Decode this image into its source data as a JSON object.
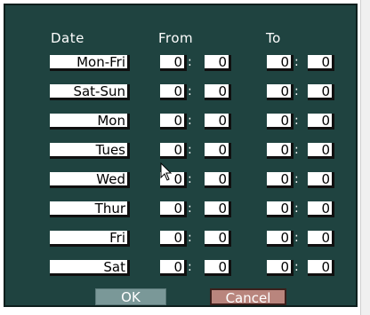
{
  "headers": {
    "date": "Date",
    "from": "From",
    "to": "To"
  },
  "rows": [
    {
      "day": "Mon-Fri",
      "from_h": "0",
      "from_m": "0",
      "to_h": "0",
      "to_m": "0"
    },
    {
      "day": "Sat-Sun",
      "from_h": "0",
      "from_m": "0",
      "to_h": "0",
      "to_m": "0"
    },
    {
      "day": "Mon",
      "from_h": "0",
      "from_m": "0",
      "to_h": "0",
      "to_m": "0"
    },
    {
      "day": "Tues",
      "from_h": "0",
      "from_m": "0",
      "to_h": "0",
      "to_m": "0"
    },
    {
      "day": "Wed",
      "from_h": "0",
      "from_m": "0",
      "to_h": "0",
      "to_m": "0"
    },
    {
      "day": "Thur",
      "from_h": "0",
      "from_m": "0",
      "to_h": "0",
      "to_m": "0"
    },
    {
      "day": "Fri",
      "from_h": "0",
      "from_m": "0",
      "to_h": "0",
      "to_m": "0"
    },
    {
      "day": "Sat",
      "from_h": "0",
      "from_m": "0",
      "to_h": "0",
      "to_m": "0"
    }
  ],
  "separator": ":",
  "buttons": {
    "ok": "OK",
    "cancel": "Cancel"
  },
  "colors": {
    "panel": "#1f4340",
    "ok": "#7a9898",
    "cancel": "#b9857d"
  }
}
